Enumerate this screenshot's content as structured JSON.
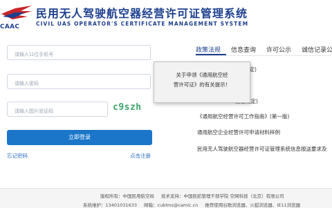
{
  "header": {
    "logo_text": "CAAC",
    "title_cn": "民用无人驾驶航空器经营许可证管理系统",
    "title_en": "CIVIL UAS OPERATOR'S CERTIFICATE MANAGEMENT SYSTEM"
  },
  "login": {
    "phone_placeholder": "请输入11位手机号",
    "password_placeholder": "请输入密码",
    "captcha_placeholder": "请输入图片验证码",
    "captcha_text": "c9szh",
    "login_label": "立即登录",
    "forgot_label": "忘记密码",
    "register_label": "点击注册"
  },
  "tabs": [
    {
      "label": "政策法规"
    },
    {
      "label": "信息查询"
    },
    {
      "label": "许可公示"
    },
    {
      "label": "诚信记录公"
    }
  ],
  "news": [
    {
      "title": "管理规定)"
    },
    {
      "title": ")"
    },
    {
      "title": "报告规定)"
    },
    {
      "title": "《通用航空经营许可工作指南》(第一版)"
    },
    {
      "title": "通用航空企业经营许可申请材料样例"
    },
    {
      "title": "民用无人驾驶航空器经营许可证管理系统信息报送要求及"
    }
  ],
  "modal": {
    "line1": "关于申领《通用航空经",
    "line2": "营许可证》的有关提示！"
  },
  "footer": {
    "copyright_label": "版权所有：",
    "copyright_value": "中国民用航空局",
    "support_label": "技术支持：",
    "support_value": "中国民航管理干部学院 空网科技（北京）有限公司",
    "maint_label": "系统维护：",
    "maint_value": "13401031633",
    "email_label": "邮箱：",
    "email_value": "cublms@camic.cn",
    "browser_note": "推荐使用谷歌浏览器、火狐浏览器、IE11浏览器"
  },
  "colors": {
    "brand": "#1d3f8f",
    "button": "#1b76c9",
    "captcha": "#3aa36b"
  }
}
